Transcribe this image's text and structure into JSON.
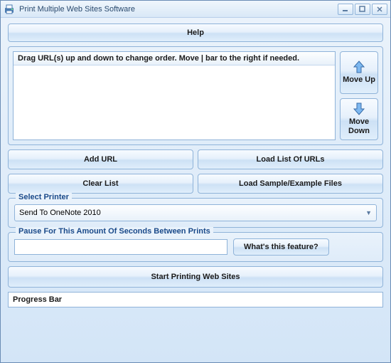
{
  "window": {
    "title": "Print Multiple Web Sites Software"
  },
  "help": {
    "label": "Help"
  },
  "list": {
    "header": "Drag URL(s) up and down to change order. Move | bar to the right if needed.",
    "move_up": "Move Up",
    "move_down": "Move Down"
  },
  "actions": {
    "add_url": "Add URL",
    "load_list": "Load List Of URLs",
    "clear_list": "Clear List",
    "load_sample": "Load Sample/Example Files"
  },
  "printer": {
    "legend": "Select Printer",
    "selected": "Send To OneNote 2010"
  },
  "pause": {
    "legend": "Pause For This Amount Of Seconds Between Prints",
    "value": "",
    "whats_this": "What's this feature?"
  },
  "start": {
    "label": "Start Printing Web Sites"
  },
  "progress": {
    "label": "Progress Bar"
  }
}
